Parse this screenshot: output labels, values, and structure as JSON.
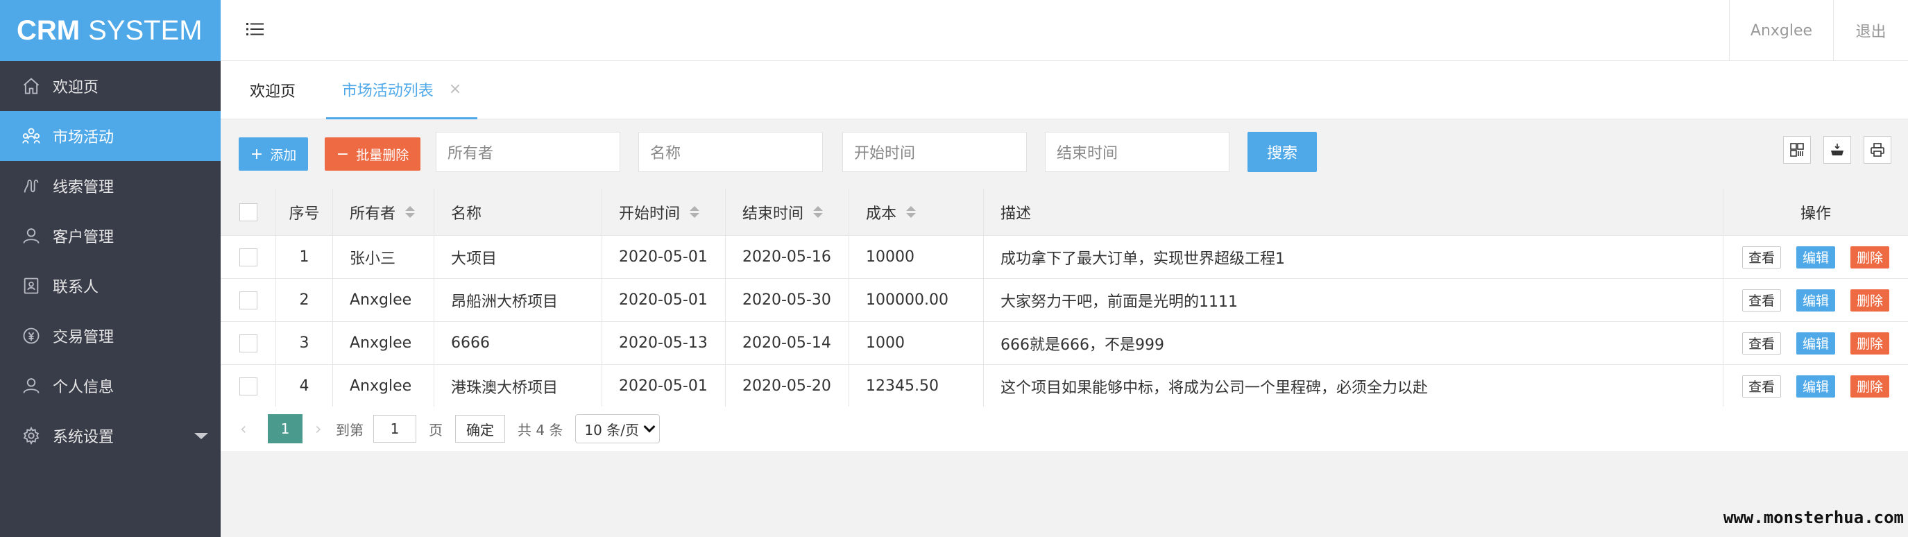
{
  "app": {
    "logo_bold": "CRM",
    "logo_rest": "SYSTEM"
  },
  "sidebar": {
    "items": [
      {
        "label": "欢迎页",
        "icon": "home-icon"
      },
      {
        "label": "市场活动",
        "icon": "users-group-icon",
        "active": true
      },
      {
        "label": "线索管理",
        "icon": "clue-icon"
      },
      {
        "label": "客户管理",
        "icon": "user-icon"
      },
      {
        "label": "联系人",
        "icon": "contact-card-icon"
      },
      {
        "label": "交易管理",
        "icon": "money-icon"
      },
      {
        "label": "个人信息",
        "icon": "user-icon"
      },
      {
        "label": "系统设置",
        "icon": "gear-icon"
      }
    ]
  },
  "header": {
    "user": "Anxglee",
    "logout": "退出"
  },
  "tabs": {
    "home": "欢迎页",
    "active": "市场活动列表",
    "close": "×"
  },
  "toolbar": {
    "add_label": "添加",
    "batch_delete_label": "批量删除",
    "owner_placeholder": "所有者",
    "name_placeholder": "名称",
    "start_placeholder": "开始时间",
    "end_placeholder": "结束时间",
    "search_label": "搜索"
  },
  "table": {
    "headers": {
      "no": "序号",
      "owner": "所有者",
      "name": "名称",
      "start": "开始时间",
      "end": "结束时间",
      "cost": "成本",
      "desc": "描述",
      "ops": "操作"
    },
    "rows": [
      {
        "no": "1",
        "owner": "张小三",
        "name": "大项目",
        "start": "2020-05-01",
        "end": "2020-05-16",
        "cost": "10000",
        "desc": "成功拿下了最大订单，实现世界超级工程1"
      },
      {
        "no": "2",
        "owner": "Anxglee",
        "name": "昂船洲大桥项目",
        "start": "2020-05-01",
        "end": "2020-05-30",
        "cost": "100000.00",
        "desc": "大家努力干吧，前面是光明的1111"
      },
      {
        "no": "3",
        "owner": "Anxglee",
        "name": "6666",
        "start": "2020-05-13",
        "end": "2020-05-14",
        "cost": "1000",
        "desc": "666就是666，不是999"
      },
      {
        "no": "4",
        "owner": "Anxglee",
        "name": "港珠澳大桥项目",
        "start": "2020-05-01",
        "end": "2020-05-20",
        "cost": "12345.50",
        "desc": "这个项目如果能够中标，将成为公司一个里程碑，必须全力以赴"
      }
    ],
    "ops": {
      "view": "查看",
      "edit": "编辑",
      "delete": "删除"
    }
  },
  "pager": {
    "prev": "‹",
    "current": "1",
    "next": "›",
    "goto_label": "到第",
    "goto_value": "1",
    "page_unit": "页",
    "confirm": "确定",
    "total": "共 4 条",
    "page_size": "10 条/页"
  },
  "watermark": "www.monsterhua.com",
  "colors": {
    "primary": "#4fa9e8",
    "danger": "#ee6a42",
    "sidebar_bg": "#393d49",
    "pager_current": "#4a9a8e"
  }
}
